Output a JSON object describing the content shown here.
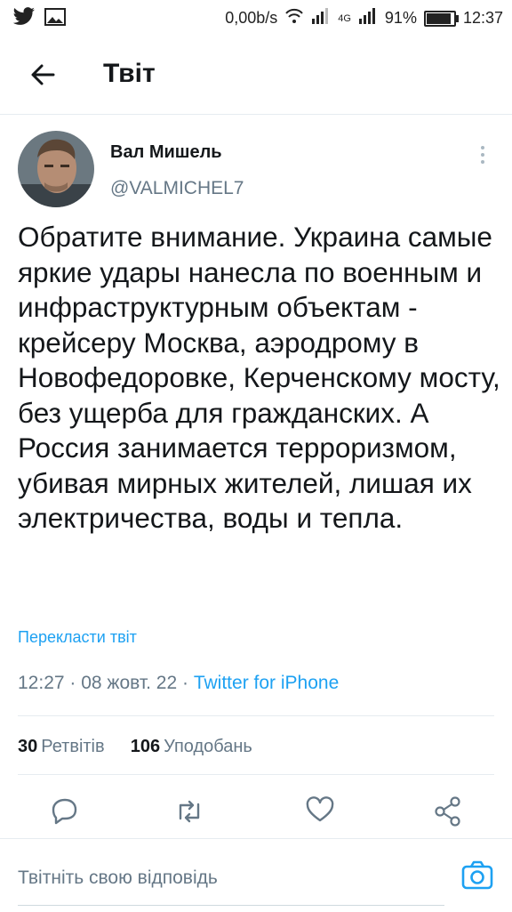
{
  "status_bar": {
    "speed": "0,00b/s",
    "network": "4G",
    "battery": "91%",
    "battery_level": 0.91,
    "time": "12:37"
  },
  "header": {
    "title": "Твіт"
  },
  "tweet": {
    "display_name": "Вал Мишель",
    "handle": "@VALMICHEL7",
    "text": "Обратите внимание. Украина самые яркие удары нанесла по военным и инфраструктурным объектам - крейсеру Москва, аэродрому в Новофедоровке, Керченскому мосту, без ущерба для гражданских. А Россия занимается терроризмом, убивая мирных жителей, лишая их электричества, воды и тепла.",
    "translate_label": "Перекласти твіт",
    "time": "12:27",
    "date": "08 жовт. 22",
    "source": "Twitter for iPhone",
    "sep": " · ",
    "retweets_count": "30",
    "retweets_label": "Ретвітів",
    "likes_count": "106",
    "likes_label": "Уподобань"
  },
  "reply": {
    "placeholder": "Твітніть свою відповідь"
  },
  "colors": {
    "accent": "#1da1f2",
    "muted": "#657786",
    "text": "#14171a"
  },
  "icons": [
    "twitter-icon",
    "gallery-icon",
    "wifi-icon",
    "signal-icon",
    "battery-icon",
    "back-arrow-icon",
    "more-vertical-icon",
    "reply-icon",
    "retweet-icon",
    "like-icon",
    "share-icon",
    "camera-icon"
  ]
}
